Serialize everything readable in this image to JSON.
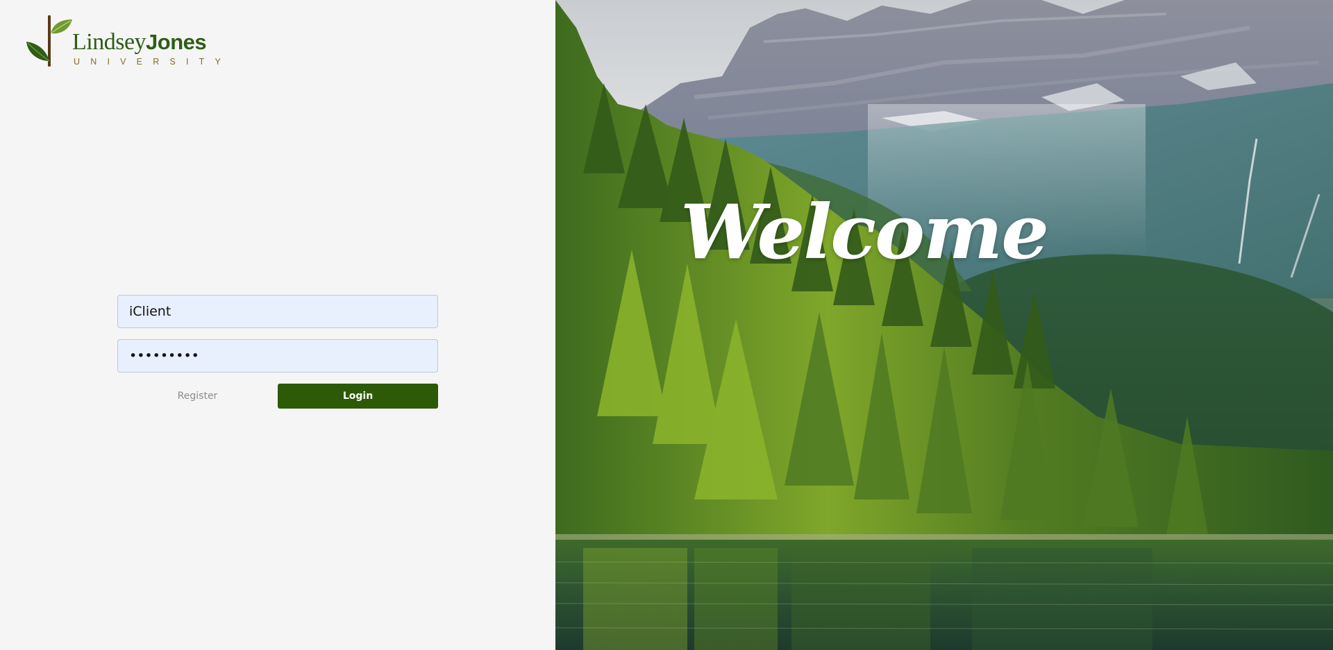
{
  "brand": {
    "name_light": "Lindsey",
    "name_bold": "Jones",
    "subtitle": "UNIVERSITY",
    "logo_icon": "sprout-leaf-icon",
    "primary_color": "#2d5a07",
    "accent_color": "#8a6b1f"
  },
  "login": {
    "username_value": "iClient",
    "password_value": "•••••••••",
    "register_label": "Register",
    "login_label": "Login"
  },
  "hero": {
    "welcome_text": "Welcome"
  }
}
